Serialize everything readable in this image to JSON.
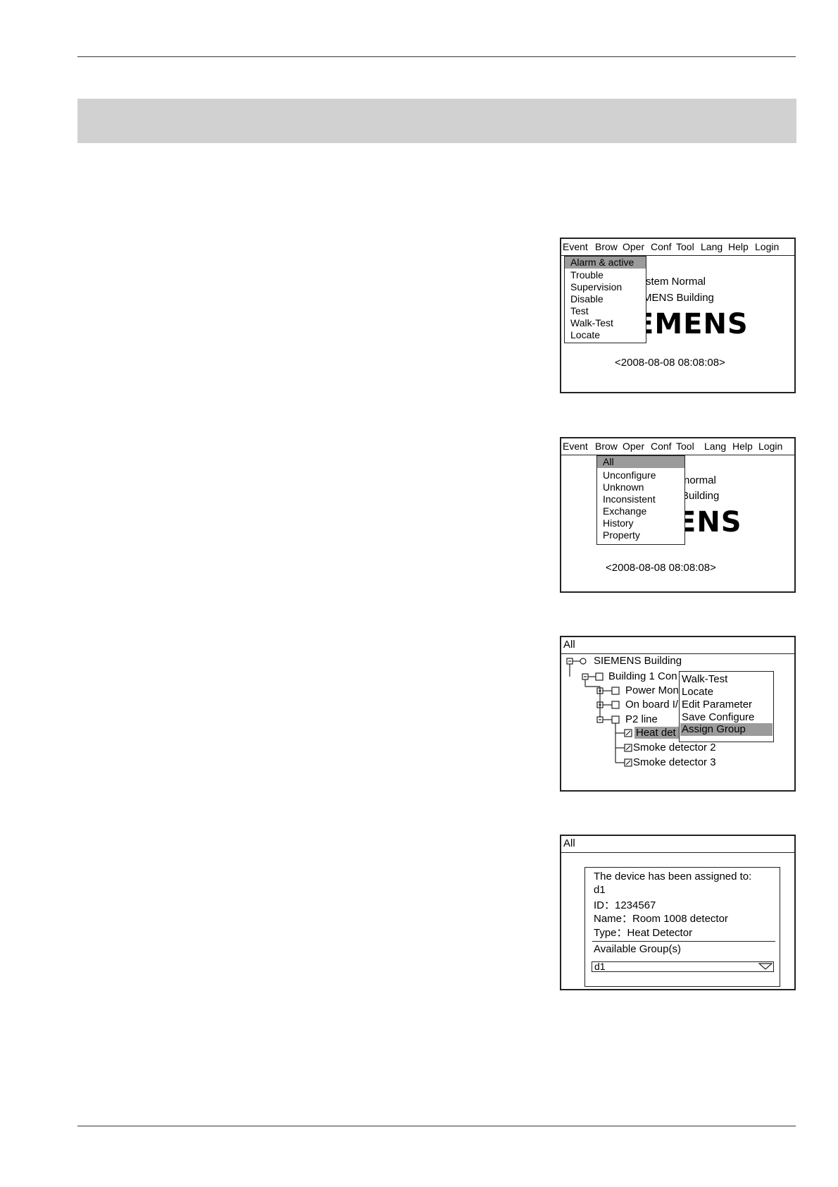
{
  "screen1": {
    "menu": [
      "Event",
      "Brow",
      "Oper",
      "Conf",
      "Tool",
      "Lang",
      "Help",
      "Login"
    ],
    "dropdown": [
      "Alarm & active",
      "Trouble",
      "Supervision",
      "Disable",
      "Test",
      "Walk-Test",
      "Locate"
    ],
    "selected_item": "Alarm & active",
    "status_line1": "stem Normal",
    "status_line2": "MENS Building",
    "logo_fragment": "EMENS",
    "datetime": "<2008-08-08   08:08:08>"
  },
  "screen2": {
    "menu": [
      "Event",
      "Brow",
      "Oper",
      "Conf",
      "Tool",
      "Lang",
      "Help",
      "Login"
    ],
    "dropdown": [
      "All",
      "Unconfigure",
      "Unknown",
      "Inconsistent",
      "Exchange",
      "History",
      "Property"
    ],
    "selected_item": "All",
    "status_line1": "normal",
    "status_line2": "Building",
    "logo_fragment": "ENS",
    "datetime": "<2008-08-08   08:08:08>"
  },
  "screen3": {
    "title": "All",
    "tree": {
      "root": "SIEMENS Building",
      "building": "Building 1 Con",
      "power": "Power Mon",
      "onboard": "On board I/",
      "p2": "P2 line",
      "heat": "Heat det",
      "smoke2": "Smoke detector 2",
      "smoke3": "Smoke detector 3"
    },
    "context_menu": [
      "Walk-Test",
      "Locate",
      "Edit Parameter",
      "Save Configure",
      "Assign Group"
    ],
    "selected_item": "Assign Group"
  },
  "screen4": {
    "title": "All",
    "dialog": {
      "line1": "The device has been assigned to:",
      "group": "d1",
      "id": "ID：1234567",
      "name": "Name：Room 1008 detector",
      "type": "Type：Heat Detector",
      "available_label": "Available Group(s)",
      "selected_group": "d1"
    }
  },
  "colors": {
    "highlight": "#9b9b9b",
    "banner": "#d1d1d1",
    "border": "#222222"
  }
}
